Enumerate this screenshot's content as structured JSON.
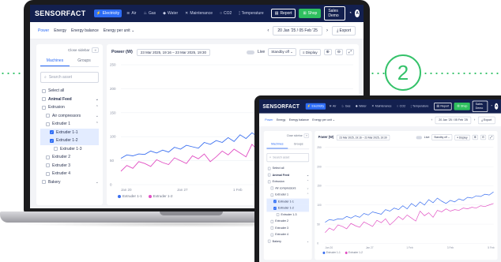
{
  "badge": "2",
  "app": {
    "logo": "SENSORFACT",
    "nav": [
      {
        "label": "Electricity",
        "icon": "bolt-icon",
        "glyph": "⚡",
        "active": true
      },
      {
        "label": "Air",
        "icon": "air-icon",
        "glyph": "≋",
        "active": false
      },
      {
        "label": "Gas",
        "icon": "flame-icon",
        "glyph": "♨",
        "active": false
      },
      {
        "label": "Water",
        "icon": "drop-icon",
        "glyph": "◆",
        "active": false
      },
      {
        "label": "Maintenance",
        "icon": "wrench-icon",
        "glyph": "✕",
        "active": false
      },
      {
        "label": "CO2",
        "icon": "co2-icon",
        "glyph": "○",
        "active": false
      },
      {
        "label": "Temperature",
        "icon": "thermometer-icon",
        "glyph": "¦",
        "active": false
      }
    ],
    "report_label": "Report",
    "shop_label": "Shop",
    "sales_label": "Sales Demo",
    "avatar": "A",
    "tabs": [
      {
        "label": "Power",
        "active": true
      },
      {
        "label": "Energy",
        "active": false
      },
      {
        "label": "Energy balance",
        "active": false
      },
      {
        "label": "Energy per unit ⌄",
        "active": false
      }
    ],
    "date_range": "20 Jan '25 / 05 Feb '25",
    "export_label": "Export",
    "sidebar": {
      "close_label": "Close sidebar",
      "tab_machines": "Machines",
      "tab_groups": "Groups",
      "search_placeholder": "Search asset",
      "select_all": "Select all",
      "items": [
        {
          "label": "Animal Feed",
          "level": 0,
          "group": true,
          "checked": false,
          "sel": false,
          "exp": "⌄"
        },
        {
          "label": "Extrusion",
          "level": 0,
          "group": false,
          "checked": false,
          "sel": false,
          "exp": "⌃"
        },
        {
          "label": "Air compressors",
          "level": 1,
          "group": false,
          "checked": false,
          "sel": false,
          "exp": "⌄"
        },
        {
          "label": "Extruder 1",
          "level": 1,
          "group": false,
          "checked": false,
          "sel": false,
          "exp": "⌃"
        },
        {
          "label": "Extruder 1-1",
          "level": 2,
          "group": false,
          "checked": true,
          "sel": true,
          "exp": ""
        },
        {
          "label": "Extruder 1-2",
          "level": 2,
          "group": false,
          "checked": true,
          "sel": true,
          "exp": ""
        },
        {
          "label": "Extruder 1-3",
          "level": 3,
          "group": false,
          "checked": false,
          "sel": false,
          "exp": ""
        },
        {
          "label": "Extruder 2",
          "level": 1,
          "group": false,
          "checked": false,
          "sel": false,
          "exp": ""
        },
        {
          "label": "Extruder 3",
          "level": 1,
          "group": false,
          "checked": false,
          "sel": false,
          "exp": ""
        },
        {
          "label": "Extruder 4",
          "level": 1,
          "group": false,
          "checked": false,
          "sel": false,
          "exp": ""
        },
        {
          "label": "Bakery",
          "level": 0,
          "group": false,
          "checked": false,
          "sel": false,
          "exp": "⌄"
        }
      ]
    },
    "chart_head": {
      "title": "Power (W)",
      "range": "23 Mar 2025, 19:16 – 23 Mar 2025, 19:30",
      "live_label": "Live",
      "standby_label": "Standby off ⌄",
      "display_label": "Display"
    }
  },
  "chart_data": {
    "type": "line",
    "ylim": [
      0,
      250
    ],
    "y_ticks": [
      "250",
      "200",
      "150",
      "100",
      "50",
      "0"
    ],
    "x_ticks": [
      "Jan 20",
      "Jan 27",
      "1 Feb",
      "3 Feb",
      "5 Feb"
    ],
    "series": [
      {
        "name": "Extruder 1-1",
        "color": "#3a6ff0",
        "values": [
          55,
          62,
          60,
          64,
          63,
          70,
          66,
          72,
          68,
          78,
          74,
          82,
          79,
          76,
          88,
          84,
          92,
          88,
          98,
          90,
          104,
          96,
          108,
          100,
          114,
          106,
          118,
          110,
          104,
          112,
          108,
          116,
          112,
          120,
          118,
          124,
          122,
          128,
          126,
          134
        ]
      },
      {
        "name": "Extruder 1-2",
        "color": "#e14fc3",
        "values": [
          28,
          40,
          34,
          48,
          44,
          38,
          52,
          46,
          42,
          56,
          50,
          44,
          60,
          54,
          64,
          48,
          58,
          70,
          62,
          74,
          66,
          58,
          84,
          72,
          80,
          68,
          86,
          82,
          90,
          84,
          88,
          86,
          92,
          90,
          94,
          92,
          98,
          96,
          100,
          104
        ]
      }
    ]
  }
}
